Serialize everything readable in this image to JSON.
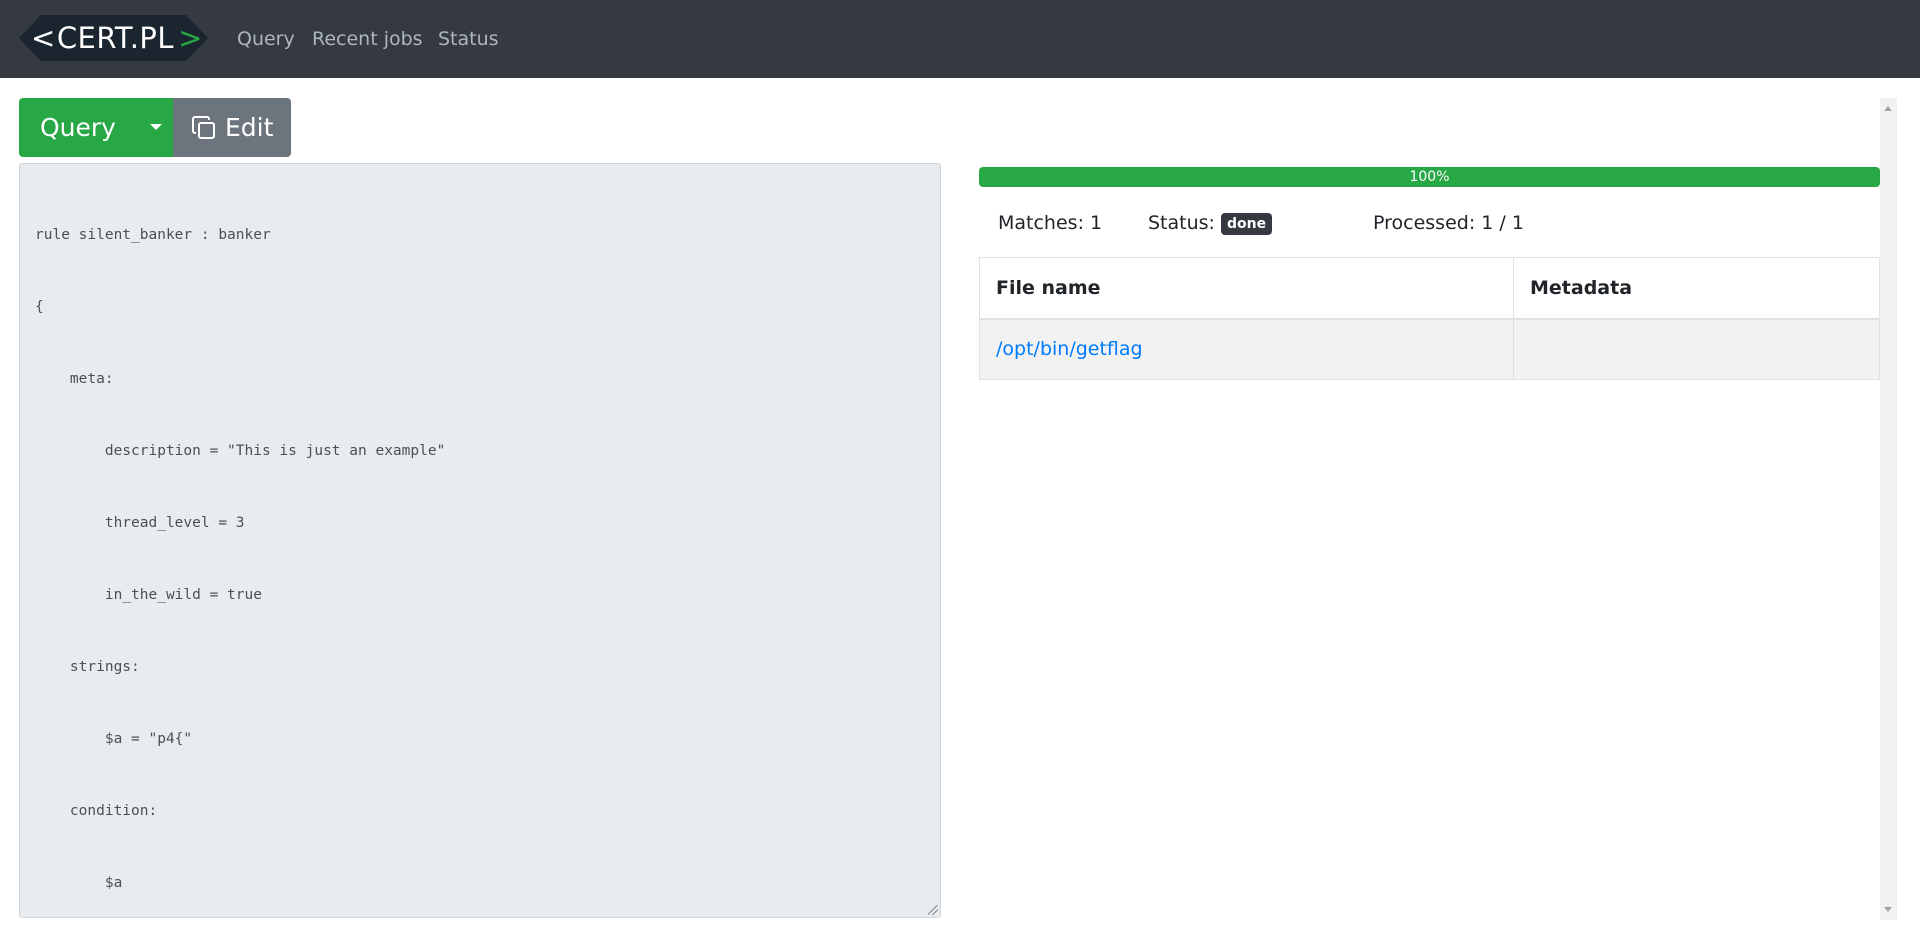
{
  "nav": {
    "logo": {
      "prefix": "<",
      "text": "CERT.PL",
      "suffix": ">"
    },
    "links": [
      "Query",
      "Recent jobs",
      "Status"
    ]
  },
  "toolbar": {
    "query_label": "Query",
    "edit_label": "Edit"
  },
  "editor": {
    "lines": [
      "rule silent_banker : banker",
      "{",
      "    meta:",
      "        description = \"This is just an example\"",
      "        thread_level = 3",
      "        in_the_wild = true",
      "    strings:",
      "        $a = \"p4{\"",
      "    condition:",
      "        $a",
      "}"
    ]
  },
  "results": {
    "progress_percent": 100,
    "progress_label": "100%",
    "matches_label": "Matches: 1",
    "status_label": "Status:",
    "status_badge": "done",
    "processed_label": "Processed: 1 / 1",
    "columns": [
      "File name",
      "Metadata"
    ],
    "rows": [
      {
        "file": "/opt/bin/getflag",
        "metadata": ""
      }
    ]
  },
  "colors": {
    "navbar": "#343a40",
    "accent_green": "#28a745",
    "secondary": "#6c757d",
    "link": "#007bff"
  }
}
